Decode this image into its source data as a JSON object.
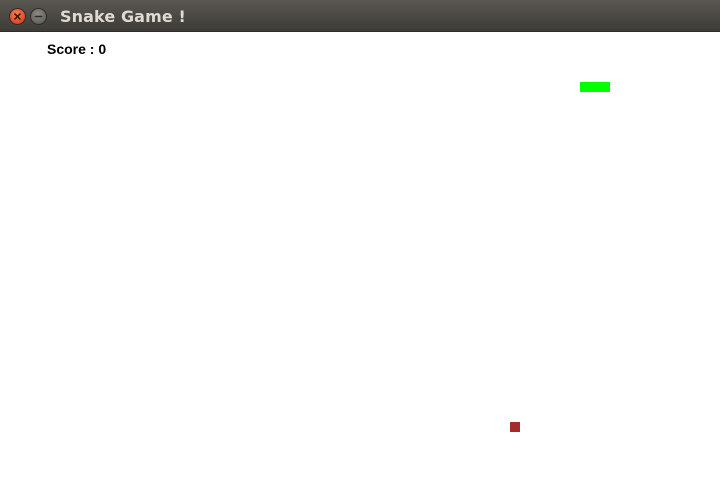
{
  "window": {
    "title": "Snake Game !",
    "buttons": {
      "close_icon": "close-icon",
      "minimize_icon": "minimize-icon"
    }
  },
  "game": {
    "score_label": "Score : 0",
    "score": 0,
    "snake": {
      "color": "#00ff00",
      "length_segments": 3,
      "direction": "horizontal"
    },
    "food": {
      "color": "#a52a2a"
    }
  }
}
